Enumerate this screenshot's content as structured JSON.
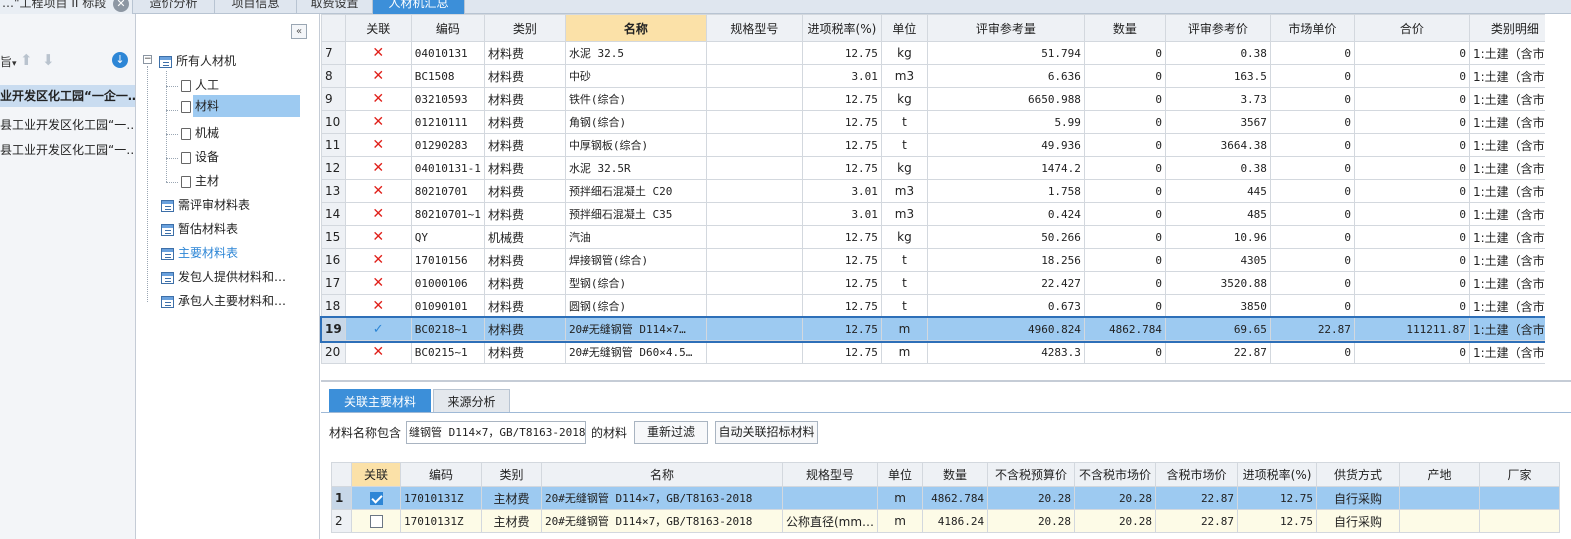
{
  "top_tabs": {
    "project_tab_label": "…\"工程项目 II 标段",
    "close_glyph": "✕",
    "tabs": [
      {
        "label": "造价分析"
      },
      {
        "label": "项目信息"
      },
      {
        "label": "取费设置"
      },
      {
        "label": "人材机汇总"
      }
    ]
  },
  "project_tree": {
    "dropdown_label": "旨",
    "items": [
      {
        "label": "业开发区化工园“一企一…"
      },
      {
        "label": "县工业开发区化工园“一…"
      },
      {
        "label": "县工业开发区化工园“一…"
      }
    ]
  },
  "category_tree": {
    "collapse_glyph": "«",
    "root": "所有人材机",
    "children": [
      "人工",
      "材料",
      "机械",
      "设备",
      "主材"
    ],
    "tables": [
      "需评审材料表",
      "暂估材料表",
      "主要材料表",
      "发包人提供材料和…",
      "承包人主要材料和…"
    ]
  },
  "main_grid": {
    "headers": [
      "关联",
      "编码",
      "类别",
      "名称",
      "规格型号",
      "进项税率(%)",
      "单位",
      "评审参考量",
      "数量",
      "评审参考价",
      "市场单价",
      "合价",
      "类别明细"
    ],
    "rows": [
      {
        "idx": "7",
        "rel": "x",
        "code": "04010131",
        "cat": "材料费",
        "name": "水泥 32.5",
        "spec": "",
        "tax": "12.75",
        "unit": "kg",
        "ref_qty": "51.794",
        "qty": "0",
        "ref_price": "0.38",
        "mkt": "0",
        "total": "0",
        "detail": "1:土建（含市…"
      },
      {
        "idx": "8",
        "rel": "x",
        "code": "BC1508",
        "cat": "材料费",
        "name": "中砂",
        "spec": "",
        "tax": "3.01",
        "unit": "m3",
        "ref_qty": "6.636",
        "qty": "0",
        "ref_price": "163.5",
        "mkt": "0",
        "total": "0",
        "detail": "1:土建（含市…"
      },
      {
        "idx": "9",
        "rel": "x",
        "code": "03210593",
        "cat": "材料费",
        "name": "铁件(综合)",
        "spec": "",
        "tax": "12.75",
        "unit": "kg",
        "ref_qty": "6650.988",
        "qty": "0",
        "ref_price": "3.73",
        "mkt": "0",
        "total": "0",
        "detail": "1:土建（含市…"
      },
      {
        "idx": "10",
        "rel": "x",
        "code": "01210111",
        "cat": "材料费",
        "name": "角钢(综合)",
        "spec": "",
        "tax": "12.75",
        "unit": "t",
        "ref_qty": "5.99",
        "qty": "0",
        "ref_price": "3567",
        "mkt": "0",
        "total": "0",
        "detail": "1:土建（含市…"
      },
      {
        "idx": "11",
        "rel": "x",
        "code": "01290283",
        "cat": "材料费",
        "name": "中厚钢板(综合)",
        "spec": "",
        "tax": "12.75",
        "unit": "t",
        "ref_qty": "49.936",
        "qty": "0",
        "ref_price": "3664.38",
        "mkt": "0",
        "total": "0",
        "detail": "1:土建（含市…"
      },
      {
        "idx": "12",
        "rel": "x",
        "code": "04010131-1",
        "cat": "材料费",
        "name": "水泥 32.5R",
        "spec": "",
        "tax": "12.75",
        "unit": "kg",
        "ref_qty": "1474.2",
        "qty": "0",
        "ref_price": "0.38",
        "mkt": "0",
        "total": "0",
        "detail": "1:土建（含市…"
      },
      {
        "idx": "13",
        "rel": "x",
        "code": "80210701",
        "cat": "材料费",
        "name": "预拌细石混凝土 C20",
        "spec": "",
        "tax": "3.01",
        "unit": "m3",
        "ref_qty": "1.758",
        "qty": "0",
        "ref_price": "445",
        "mkt": "0",
        "total": "0",
        "detail": "1:土建（含市…"
      },
      {
        "idx": "14",
        "rel": "x",
        "code": "80210701~1",
        "cat": "材料费",
        "name": "预拌细石混凝土 C35",
        "spec": "",
        "tax": "3.01",
        "unit": "m3",
        "ref_qty": "0.424",
        "qty": "0",
        "ref_price": "485",
        "mkt": "0",
        "total": "0",
        "detail": "1:土建（含市…"
      },
      {
        "idx": "15",
        "rel": "x",
        "code": "QY",
        "cat": "机械费",
        "name": "汽油",
        "spec": "",
        "tax": "12.75",
        "unit": "kg",
        "ref_qty": "50.266",
        "qty": "0",
        "ref_price": "10.96",
        "mkt": "0",
        "total": "0",
        "detail": "1:土建（含市…"
      },
      {
        "idx": "16",
        "rel": "x",
        "code": "17010156",
        "cat": "材料费",
        "name": "焊接钢管(综合)",
        "spec": "",
        "tax": "12.75",
        "unit": "t",
        "ref_qty": "18.256",
        "qty": "0",
        "ref_price": "4305",
        "mkt": "0",
        "total": "0",
        "detail": "1:土建（含市…"
      },
      {
        "idx": "17",
        "rel": "x",
        "code": "01000106",
        "cat": "材料费",
        "name": "型钢(综合)",
        "spec": "",
        "tax": "12.75",
        "unit": "t",
        "ref_qty": "22.427",
        "qty": "0",
        "ref_price": "3520.88",
        "mkt": "0",
        "total": "0",
        "detail": "1:土建（含市…"
      },
      {
        "idx": "18",
        "rel": "x",
        "code": "01090101",
        "cat": "材料费",
        "name": "圆钢(综合)",
        "spec": "",
        "tax": "12.75",
        "unit": "t",
        "ref_qty": "0.673",
        "qty": "0",
        "ref_price": "3850",
        "mkt": "0",
        "total": "0",
        "detail": "1:土建（含市…"
      },
      {
        "idx": "19",
        "rel": "check",
        "code": "BC0218~1",
        "cat": "材料费",
        "name": "20#无缝钢管 D114×7…",
        "spec": "",
        "tax": "12.75",
        "unit": "m",
        "ref_qty": "4960.824",
        "qty": "4862.784",
        "ref_price": "69.65",
        "mkt": "22.87",
        "total": "111211.87",
        "detail": "1:土建（含市…",
        "selected": true
      },
      {
        "idx": "20",
        "rel": "x",
        "code": "BC0215~1",
        "cat": "材料费",
        "name": "20#无缝钢管 D60×4.5…",
        "spec": "",
        "tax": "12.75",
        "unit": "m",
        "ref_qty": "4283.3",
        "qty": "0",
        "ref_price": "22.87",
        "mkt": "0",
        "total": "0",
        "detail": "1:土建（含市…"
      }
    ]
  },
  "bottom_tabs": [
    {
      "label": "关联主要材料"
    },
    {
      "label": "来源分析"
    }
  ],
  "filter": {
    "label": "材料名称包含",
    "value": "缝钢管 D114×7，GB/T8163-2018",
    "suffix": "的材料",
    "refilter_button": "重新过滤",
    "auto_link_button": "自动关联招标材料"
  },
  "sub_grid": {
    "headers": [
      "关联",
      "编码",
      "类别",
      "名称",
      "规格型号",
      "单位",
      "数量",
      "不含税预算价",
      "不含税市场价",
      "含税市场价",
      "进项税率(%)",
      "供货方式",
      "产地",
      "厂家"
    ],
    "rows": [
      {
        "idx": "1",
        "checked": true,
        "code": "17010131Z",
        "cat": "主材费",
        "name": "20#无缝钢管 D114×7，GB/T8163-2018",
        "spec": "",
        "unit": "m",
        "qty": "4862.784",
        "pre_budget": "20.28",
        "pre_market": "20.28",
        "market": "22.87",
        "tax": "12.75",
        "supply": "自行采购",
        "origin": "",
        "maker": "",
        "selected": true
      },
      {
        "idx": "2",
        "checked": false,
        "code": "17010131Z",
        "cat": "主材费",
        "name": "20#无缝钢管 D114×7，GB/T8163-2018",
        "spec": "公称直径(mm…",
        "unit": "m",
        "qty": "4186.24",
        "pre_budget": "20.28",
        "pre_market": "20.28",
        "market": "22.87",
        "tax": "12.75",
        "supply": "自行采购",
        "origin": "",
        "maker": ""
      }
    ]
  },
  "colors": {
    "accent": "#3c8fd9",
    "selected_row": "#9dcaf1",
    "name_header": "#fbe1a8",
    "error_x": "#e0201a"
  }
}
